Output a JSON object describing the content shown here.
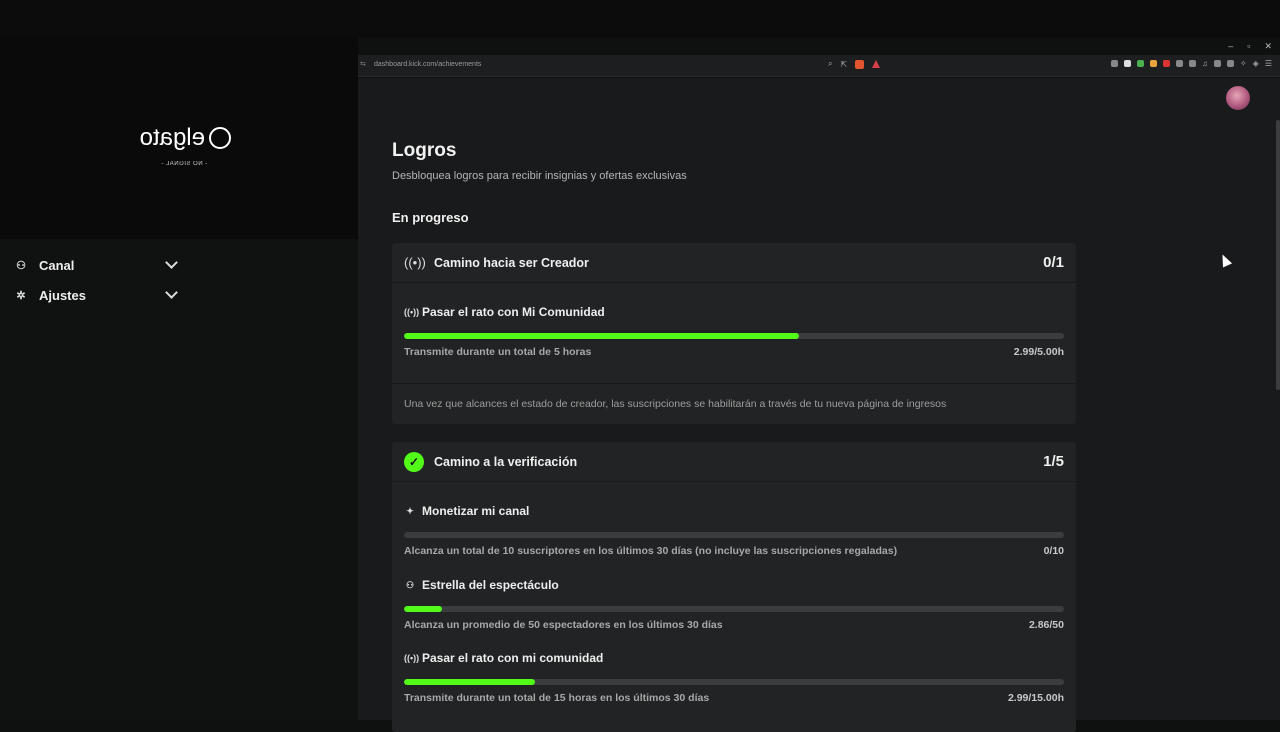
{
  "browser": {
    "url": "dashboard.kick.com/achievements",
    "window_controls": [
      "–",
      "▫",
      "✕"
    ]
  },
  "overlay": {
    "logo_text": "elgato",
    "status": "- NO SIGNAL -"
  },
  "sidebar": {
    "items": [
      {
        "label": "Canal",
        "icon": "users-icon"
      },
      {
        "label": "Ajustes",
        "icon": "gear-icon"
      }
    ]
  },
  "page": {
    "title": "Logros",
    "subtitle": "Desbloquea logros para recibir insignias y ofertas exclusivas",
    "section": "En progreso"
  },
  "cards": [
    {
      "title": "Camino hacia ser Creador",
      "count": "0/1",
      "icon": "broadcast-icon",
      "tasks": [
        {
          "name": "Pasar el rato con Mi Comunidad",
          "icon": "broadcast-icon",
          "desc": "Transmite durante un total de 5 horas",
          "value": "2.99/5.00h",
          "progress": 0.598
        }
      ],
      "note": "Una vez que alcances el estado de creador, las suscripciones se habilitarán a través de tu nueva página de ingresos"
    },
    {
      "title": "Camino a la verificación",
      "count": "1/5",
      "icon": "verified-badge-icon",
      "tasks": [
        {
          "name": "Monetizar mi canal",
          "icon": "sparkle-icon",
          "desc": "Alcanza un total de 10 suscriptores en los últimos 30 días (no incluye las suscripciones regaladas)",
          "value": "0/10",
          "progress": 0.0
        },
        {
          "name": "Estrella del espectáculo",
          "icon": "users-icon",
          "desc": "Alcanza un promedio de 50 espectadores en los últimos 30 días",
          "value": "2.86/50",
          "progress": 0.057
        },
        {
          "name": "Pasar el rato con mi comunidad",
          "icon": "broadcast-icon",
          "desc": "Transmite durante un total de 15 horas en los últimos 30 días",
          "value": "2.99/15.00h",
          "progress": 0.199
        }
      ]
    }
  ],
  "colors": {
    "accent": "#53fc18",
    "background": "#191a1b",
    "card": "#212324"
  }
}
